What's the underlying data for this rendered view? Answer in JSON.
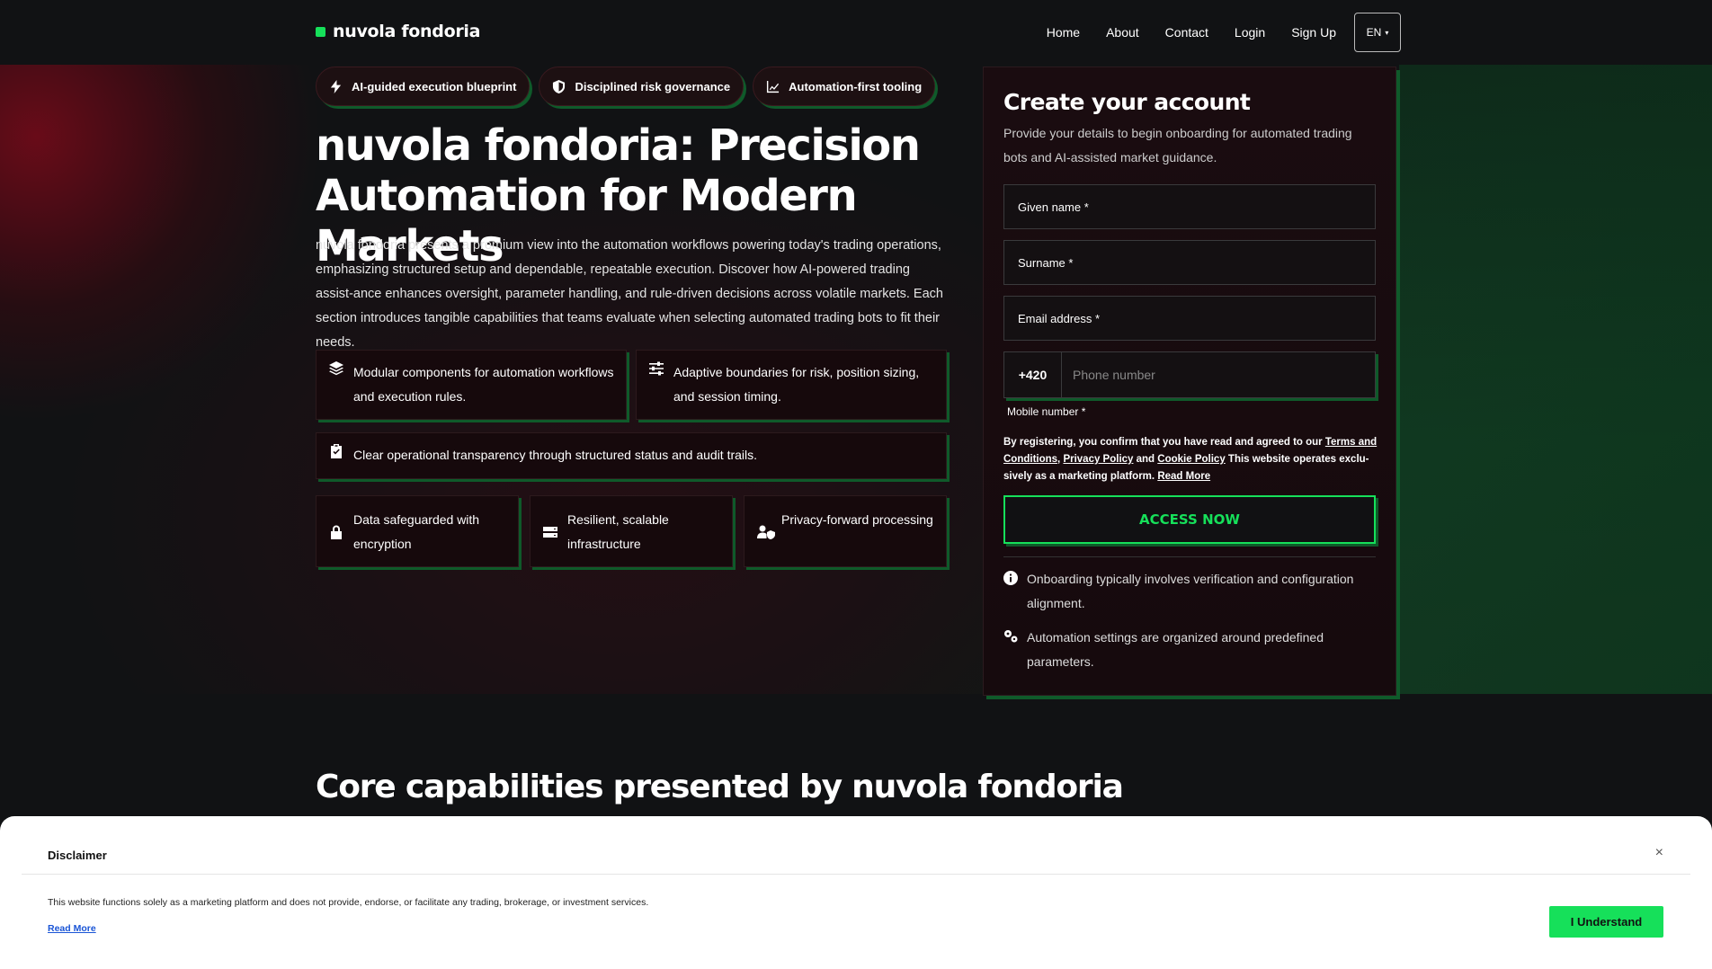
{
  "brand": {
    "name": "nuvola fondoria",
    "accent": "#16e05a"
  },
  "nav": {
    "items": [
      "Home",
      "About",
      "Contact",
      "Login",
      "Sign Up"
    ],
    "lang": "EN"
  },
  "pills": [
    {
      "label": "AI-guided execution blueprint",
      "icon": "bolt-icon"
    },
    {
      "label": "Disciplined risk governance",
      "icon": "shield-icon"
    },
    {
      "label": "Automation-first tooling",
      "icon": "chart-line-icon"
    }
  ],
  "hero": {
    "title": "nuvola fondoria: Precision Automation for Modern Markets",
    "description": "nuvola fondoria presents a premium view into the automation workflows powering today's trading operations, emphasizing structured setup and dependable, repeatable execution. Discover how AI-powered trading assist-ance enhances oversight, parameter handling, and rule-driven decisions across volatile markets. Each section introduces tangible capabilities that teams evaluate when selecting automated trading bots to fit their needs."
  },
  "features": [
    {
      "text": "Modular components for automation workflows and execution rules.",
      "icon": "layers-icon"
    },
    {
      "text": "Adaptive boundaries for risk, position sizing, and session timing.",
      "icon": "sliders-icon"
    },
    {
      "text": "Clear operational transparency through structured status and audit trails.",
      "icon": "clipboard-check-icon"
    }
  ],
  "trust": [
    {
      "text": "Data safeguarded with encryption",
      "icon": "lock-icon"
    },
    {
      "text": "Resilient, scalable infrastructure",
      "icon": "server-icon"
    },
    {
      "text": "Privacy-forward processing",
      "icon": "user-shield-icon"
    }
  ],
  "form": {
    "title": "Create your account",
    "subtitle": "Provide your details to begin onboarding for automated trading bots and AI-assisted market guidance.",
    "given_name": "Given name *",
    "surname": "Surname *",
    "email": "Email address *",
    "phone_code": "+420",
    "phone_placeholder": "Phone number",
    "mobile_label": "Mobile number *",
    "legal_prefix": "By registering, you confirm that you have read and agreed to our",
    "terms": "Terms and Conditions",
    "privacy": "Privacy Policy",
    "and": "and",
    "cookie": "Cookie Policy",
    "legal_suffix": "This website operates exclu-sively as a marketing platform.",
    "read_more": "Read More",
    "submit": "ACCESS NOW",
    "notes": [
      {
        "text": "Onboarding typically involves verification and configuration alignment.",
        "icon": "info-icon"
      },
      {
        "text": "Automation settings are organized around predefined parameters.",
        "icon": "gears-icon"
      }
    ]
  },
  "section": {
    "title": "Core capabilities presented by nuvola fondoria"
  },
  "disclaimer": {
    "title": "Disclaimer",
    "text": "This website functions solely as a marketing platform and does not provide, endorse, or facilitate any trading, brokerage, or investment services.",
    "read_more": "Read More",
    "button": "I Understand",
    "close": "×"
  }
}
